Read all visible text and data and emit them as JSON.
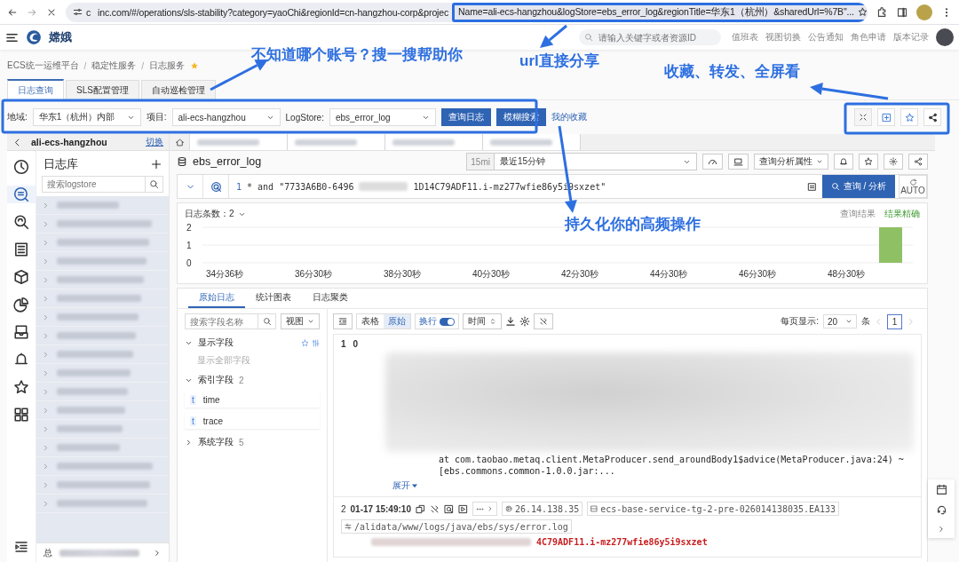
{
  "browser": {
    "url_prefix": "c",
    "url": "inc.com/#/operations/sls-stability?category=yaoChi&regionId=cn-hangzhou-corp&projec",
    "url_framed": "Name=ali-ecs-hangzhou&logStore=ebs_error_log&regionTitle=华东1（杭州）&sharedUrl=%7B\"..."
  },
  "header": {
    "logo_text": "嫦娥",
    "search_placeholder": "请输入关键字或者资源ID",
    "links": [
      "值班表",
      "视图切换",
      "公告通知",
      "角色申请",
      "版本记录"
    ]
  },
  "breadcrumb": {
    "items": [
      "ECS统一运维平台",
      "稳定性服务",
      "日志服务"
    ],
    "separator": "/",
    "favorite": true
  },
  "tabs": [
    {
      "label": "日志查询",
      "selected": true
    },
    {
      "label": "SLS配置管理",
      "selected": false
    },
    {
      "label": "自动巡检管理",
      "selected": false
    }
  ],
  "filters": [
    {
      "label": "地域:",
      "value": "华东1（杭州）内部"
    },
    {
      "label": "项目:",
      "value": "ali-ecs-hangzhou"
    },
    {
      "label": "LogStore:",
      "value": "ebs_error_log"
    }
  ],
  "filter_buttons": [
    "查询日志",
    "模糊搜索"
  ],
  "favorites_link": "我的收藏",
  "sidebar": {
    "project": "ali-ecs-hangzhou",
    "switch_link": "切换",
    "rail": [
      {
        "kind": "clock",
        "selected": false
      },
      {
        "kind": "search",
        "selected": true
      },
      {
        "kind": "scan",
        "selected": false
      },
      {
        "kind": "report",
        "selected": false
      },
      {
        "kind": "cube",
        "selected": false
      },
      {
        "kind": "pie",
        "selected": false
      },
      {
        "kind": "inbox",
        "selected": false
      },
      {
        "kind": "bell",
        "selected": false
      },
      {
        "kind": "star",
        "selected": false
      },
      {
        "kind": "grid",
        "selected": false
      }
    ],
    "title": "日志库",
    "search_placeholder": "搜索logstore",
    "footer": "总"
  },
  "content": {
    "logstore": "ebs_error_log",
    "time_short": "15mi",
    "time_range": "最近15分钟",
    "analysis_button": "查询分析属性",
    "query": {
      "line": "1",
      "text_start": "* and \"7733A6B0-6496",
      "text_end": "1D14C79ADF11.i-mz277wfie86y5i9sxzet\""
    },
    "search_button": "查询 / 分析",
    "auto_label": "AUTO",
    "histogram": {
      "count_label": "日志条数：",
      "count": "2",
      "result_label": "查询结果",
      "result_status": "结果精确",
      "chart_data": {
        "type": "bar",
        "categories": [
          "34分36秒",
          null,
          "36分30秒",
          null,
          "38分30秒",
          null,
          "40分30秒",
          null,
          "42分30秒",
          null,
          "44分30秒",
          null,
          "46分30秒",
          null,
          "48分30秒",
          null
        ],
        "values": [
          0,
          0,
          0,
          0,
          0,
          0,
          0,
          0,
          0,
          0,
          0,
          0,
          0,
          0,
          0,
          2
        ],
        "ylim": [
          0,
          2
        ],
        "yticks": [
          0,
          1,
          2
        ]
      }
    },
    "result_tabs": [
      {
        "label": "原始日志",
        "selected": true
      },
      {
        "label": "统计图表",
        "selected": false
      },
      {
        "label": "日志聚类",
        "selected": false
      }
    ],
    "fields": {
      "search_placeholder": "搜索字段名称",
      "view_select": "视图",
      "groups": [
        {
          "label": "显示字段",
          "expanded": true,
          "empty_text": "显示全部字段"
        },
        {
          "label": "索引字段",
          "count": "2",
          "expanded": true,
          "children": [
            {
              "type": "t",
              "name": "time"
            },
            {
              "type": "t",
              "name": "trace"
            }
          ]
        },
        {
          "label": "系统字段",
          "count": "5",
          "expanded": false
        }
      ]
    },
    "view_modes": [
      {
        "label": "表格",
        "selected": false
      },
      {
        "label": "原始",
        "selected": true
      }
    ],
    "wrap": {
      "label": "换行",
      "on": true
    },
    "sort_label": "时间",
    "pagination": {
      "label": "每页显示:",
      "page_size": "20",
      "unit": "条",
      "page": "1"
    },
    "logs": [
      {
        "index": "1",
        "time": "0",
        "lines": [
          "at com.taobao.metaq.client.MetaProducer.send_aroundBody1$advice(MetaProducer.java:24) ~[ebs.commons.common-1.0.0.jar:..."
        ],
        "expand": "展开"
      },
      {
        "index": "2",
        "time": "01-17 15:49:10",
        "ip": "26.14.138.35",
        "host": "ecs-base-service-tg-2-pre-026014138035.EA133",
        "path": "/alidata/www/logs/java/ebs/sys/error.log",
        "highlight": "4C79ADF11.i-mz277wfie86y5i9sxzet"
      }
    ]
  },
  "annotations": [
    "不知道哪个账号？搜一搜帮助你",
    "url直接分享",
    "收藏、转发、全屏看",
    "持久化你的高频操作"
  ]
}
